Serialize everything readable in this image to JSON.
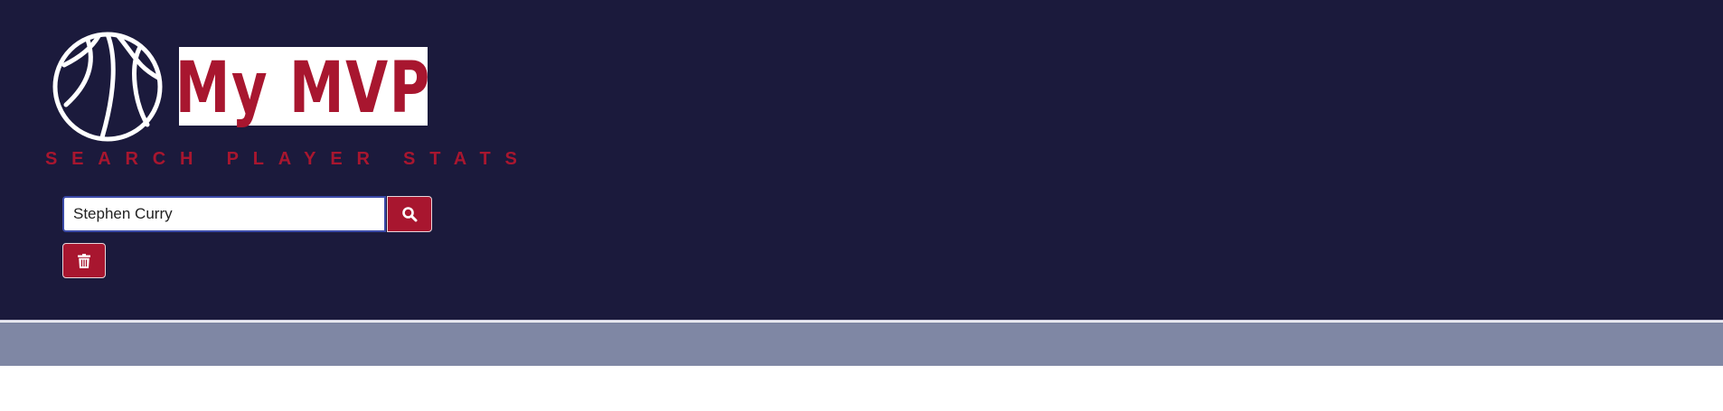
{
  "app": {
    "title": "My MVP",
    "subtitle": "SEARCH PLAYER STATS"
  },
  "search": {
    "value": "Stephen Curry",
    "button_icon": "search-icon"
  },
  "actions": {
    "delete_icon": "trash-icon"
  },
  "colors": {
    "header_bg": "#1b1a3c",
    "brand_red": "#a8162f",
    "band": "#7f87a4",
    "page_bg": "#ffffff"
  },
  "icons": {
    "logo": "basketball-icon"
  }
}
